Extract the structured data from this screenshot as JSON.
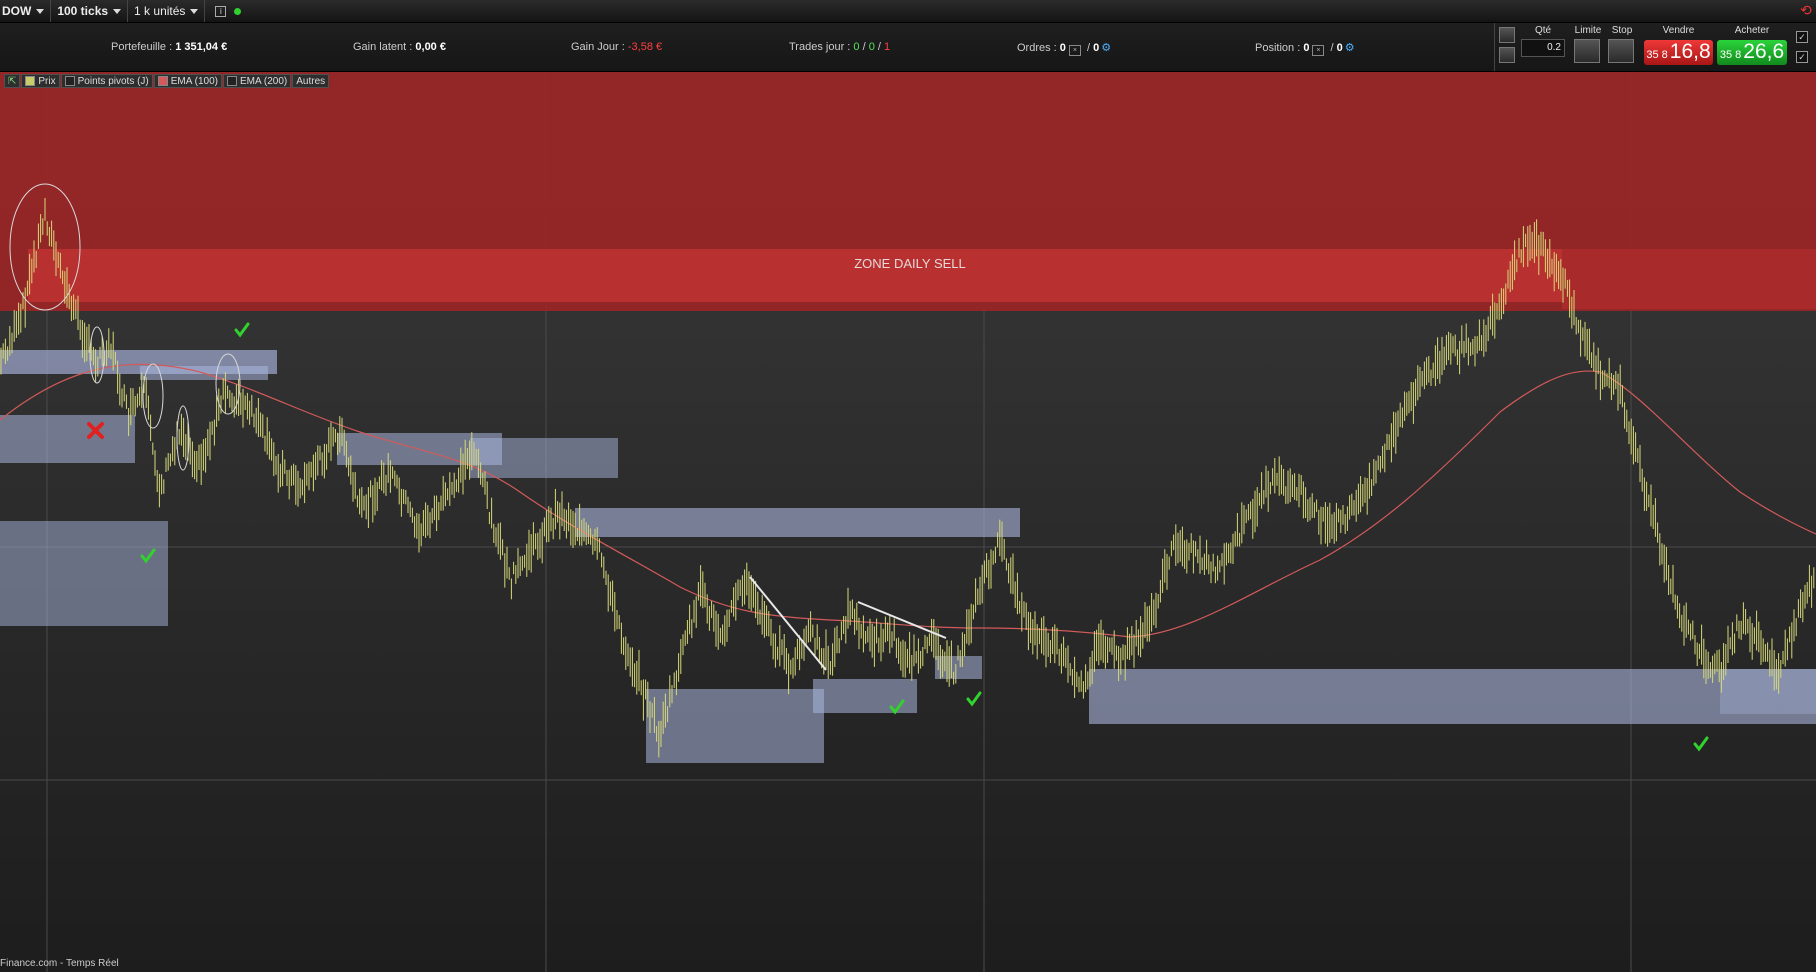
{
  "toolbar": {
    "symbol": "DOW",
    "ticks": "100 ticks",
    "units": "1 k unités",
    "info_icon": "i"
  },
  "stats": {
    "portfolio_label": "Portefeuille :",
    "portfolio_value": "1 351,04 €",
    "latent_label": "Gain latent :",
    "latent_value": "0,00 €",
    "day_label": "Gain Jour :",
    "day_value": "-3,58 €",
    "trades_label": "Trades jour :",
    "trades_a": "0",
    "trades_b": "0",
    "trades_c": "1",
    "orders_label": "Ordres :",
    "orders_a": "0",
    "orders_b": "0",
    "position_label": "Position :",
    "position_a": "0",
    "position_b": "0"
  },
  "trade": {
    "qty_label": "Qté",
    "qty_value": "0.2",
    "limit_label": "Limite",
    "stop_label": "Stop",
    "sell_label": "Vendre",
    "buy_label": "Acheter",
    "sell_small": "35 8",
    "sell_big": "16,8",
    "buy_small": "35 8",
    "buy_big": "26,6"
  },
  "legend": {
    "price": "Prix",
    "pivots": "Points pivots (J)",
    "ema100": "EMA (100)",
    "ema200": "EMA (200)",
    "others": "Autres"
  },
  "chart": {
    "zone_label": "ZONE DAILY SELL"
  },
  "colors": {
    "price": "#d6d978",
    "ema100": "#d25a5a",
    "zone": "#b52828",
    "box": "#a4b2dc",
    "sell": "#d92020",
    "buy": "#1fb12a"
  },
  "footer": {
    "source": "Finance.com - Temps Réel"
  }
}
